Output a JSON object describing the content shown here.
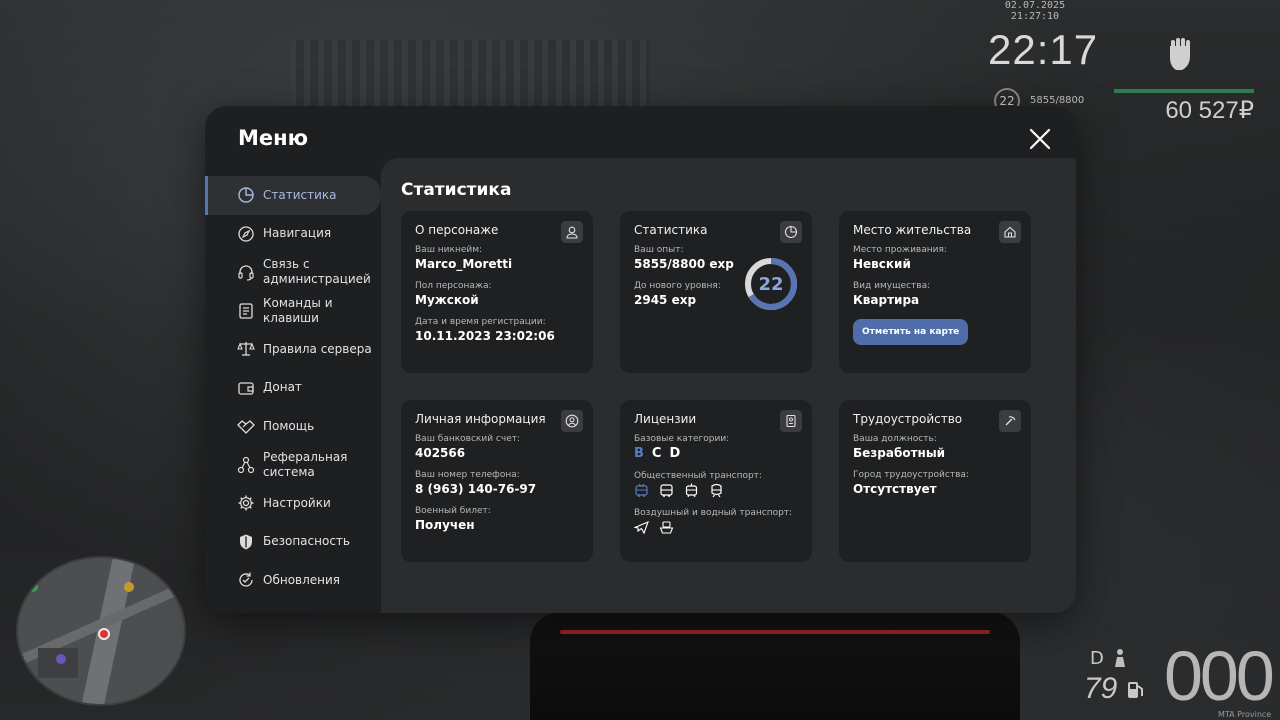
{
  "hud": {
    "date": "02.07.2025 21:27:10",
    "time": "22:17",
    "level": "22",
    "exp": "5855/8800",
    "money": "60 527₽",
    "gear": "D",
    "speed": "000",
    "fuel": "79",
    "server": "MTA Province"
  },
  "menu": {
    "title": "Меню",
    "sidebar": [
      {
        "label": "Статистика",
        "icon": "pie-chart-icon"
      },
      {
        "label": "Навигация",
        "icon": "compass-icon"
      },
      {
        "label": "Связь с администрацией",
        "icon": "headset-icon"
      },
      {
        "label": "Команды и клавиши",
        "icon": "keyboard-doc-icon"
      },
      {
        "label": "Правила сервера",
        "icon": "scales-icon"
      },
      {
        "label": "Донат",
        "icon": "wallet-icon"
      },
      {
        "label": "Помощь",
        "icon": "handshake-icon"
      },
      {
        "label": "Реферальная система",
        "icon": "network-icon"
      },
      {
        "label": "Настройки",
        "icon": "gear-icon"
      },
      {
        "label": "Безопасность",
        "icon": "shield-icon"
      },
      {
        "label": "Обновления",
        "icon": "refresh-check-icon"
      }
    ],
    "content_title": "Статистика",
    "cards": {
      "character": {
        "title": "О персонаже",
        "nickname_label": "Ваш никнейм:",
        "nickname": "Marco_Moretti",
        "gender_label": "Пол персонажа:",
        "gender": "Мужской",
        "reg_label": "Дата и время регистрации:",
        "reg": "10.11.2023 23:02:06"
      },
      "stats": {
        "title": "Статистика",
        "exp_label": "Ваш опыт:",
        "exp": "5855/8800 exp",
        "next_label": "До нового уровня:",
        "next": "2945 exp",
        "level": "22",
        "progress": 0.665
      },
      "residence": {
        "title": "Место жительства",
        "place_label": "Место проживания:",
        "place": "Невский",
        "prop_label": "Вид имущества:",
        "prop": "Квартира",
        "button": "Отметить на карте"
      },
      "personal": {
        "title": "Личная информация",
        "bank_label": "Ваш банковский счет:",
        "bank": "402566",
        "phone_label": "Ваш номер телефона:",
        "phone": "8 (963) 140-76-97",
        "military_label": "Военный билет:",
        "military": "Получен"
      },
      "licenses": {
        "title": "Лицензии",
        "base_label": "Базовые категории:",
        "categories": [
          "B",
          "C",
          "D"
        ],
        "public_label": "Общественный транспорт:",
        "air_label": "Воздушный и водный транспорт:"
      },
      "employment": {
        "title": "Трудоустройство",
        "position_label": "Ваша должность:",
        "position": "Безработный",
        "city_label": "Город трудоустройства:",
        "city": "Отсутствует"
      }
    }
  },
  "colors": {
    "accent": "#4f6ea9",
    "active_text": "#a9b9dd",
    "ring": "#5874b3",
    "health": "#2f7d4e"
  }
}
